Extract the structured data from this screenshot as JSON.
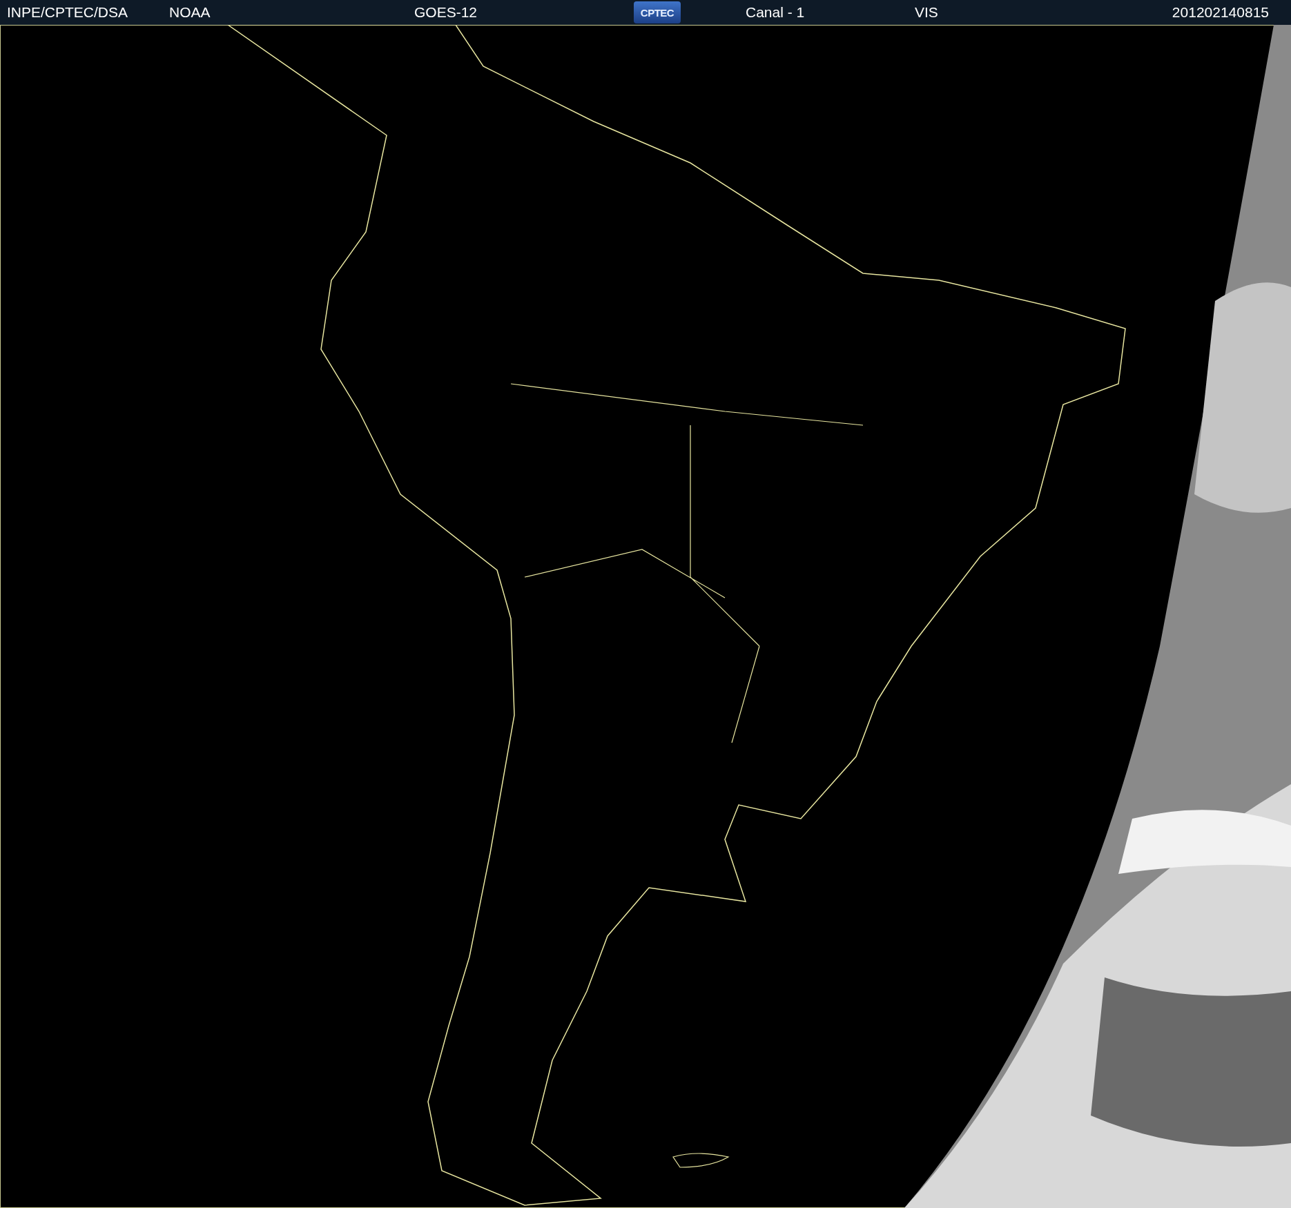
{
  "header": {
    "source": "INPE/CPTEC/DSA",
    "agency": "NOAA",
    "satellite": "GOES-12",
    "logo": "CPTEC",
    "channel": "Canal - 1",
    "band": "VIS",
    "timestamp": "201202140815"
  }
}
